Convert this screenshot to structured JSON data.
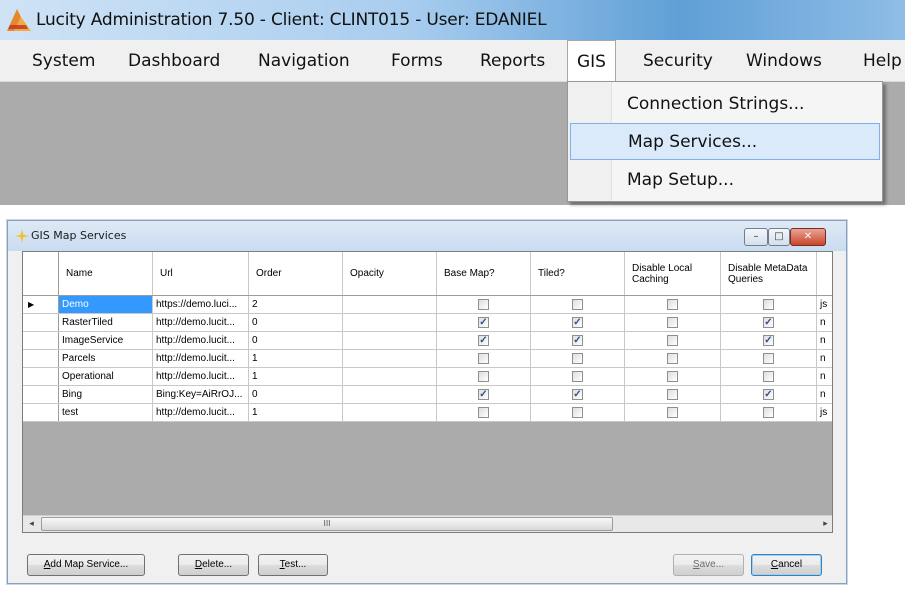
{
  "app": {
    "title": "Lucity Administration 7.50 - Client: CLINT015 - User: EDANIEL",
    "menu": [
      "System",
      "Dashboard",
      "Navigation",
      "Forms",
      "Reports",
      "GIS",
      "Security",
      "Windows",
      "Help"
    ],
    "active_menu": "GIS",
    "gis_dropdown": [
      "Connection Strings...",
      "Map Services...",
      "Map Setup..."
    ],
    "highlighted_item": "Map Services..."
  },
  "dialog": {
    "title": "GIS Map Services",
    "window_buttons": [
      "minimize",
      "maximize",
      "close"
    ],
    "columns": [
      "Name",
      "Url",
      "Order",
      "Opacity",
      "Base Map?",
      "Tiled?",
      "Disable Local Caching",
      "Disable MetaData Queries"
    ],
    "rows": [
      {
        "name": "Demo",
        "url": "https://demo.luci...",
        "order": "2",
        "opacity": "",
        "base_map": false,
        "tiled": false,
        "disable_local_caching": false,
        "disable_metadata_queries": false,
        "extra": "js",
        "selected": true
      },
      {
        "name": "RasterTiled",
        "url": "http://demo.lucit...",
        "order": "0",
        "opacity": "",
        "base_map": true,
        "tiled": true,
        "disable_local_caching": false,
        "disable_metadata_queries": true,
        "extra": "n"
      },
      {
        "name": "ImageService",
        "url": "http://demo.lucit...",
        "order": "0",
        "opacity": "",
        "base_map": true,
        "tiled": true,
        "disable_local_caching": false,
        "disable_metadata_queries": true,
        "extra": "n"
      },
      {
        "name": "Parcels",
        "url": "http://demo.lucit...",
        "order": "1",
        "opacity": "",
        "base_map": false,
        "tiled": false,
        "disable_local_caching": false,
        "disable_metadata_queries": false,
        "extra": "n"
      },
      {
        "name": "Operational",
        "url": "http://demo.lucit...",
        "order": "1",
        "opacity": "",
        "base_map": false,
        "tiled": false,
        "disable_local_caching": false,
        "disable_metadata_queries": false,
        "extra": "n"
      },
      {
        "name": "Bing",
        "url": "Bing:Key=AiRrOJ...",
        "order": "0",
        "opacity": "",
        "base_map": true,
        "tiled": true,
        "disable_local_caching": false,
        "disable_metadata_queries": true,
        "extra": "n"
      },
      {
        "name": "test",
        "url": "http://demo.lucit...",
        "order": "1",
        "opacity": "",
        "base_map": false,
        "tiled": false,
        "disable_local_caching": false,
        "disable_metadata_queries": false,
        "extra": "js"
      }
    ],
    "scroll_thumb_glyph": "III",
    "buttons": {
      "add": {
        "prefix": "A",
        "rest": "dd Map Service..."
      },
      "delete": {
        "prefix": "D",
        "rest": "elete..."
      },
      "test": {
        "prefix": "T",
        "rest": "est..."
      },
      "save": {
        "prefix": "S",
        "rest": "ave..."
      },
      "cancel": {
        "prefix": "C",
        "rest": "ancel"
      }
    }
  }
}
